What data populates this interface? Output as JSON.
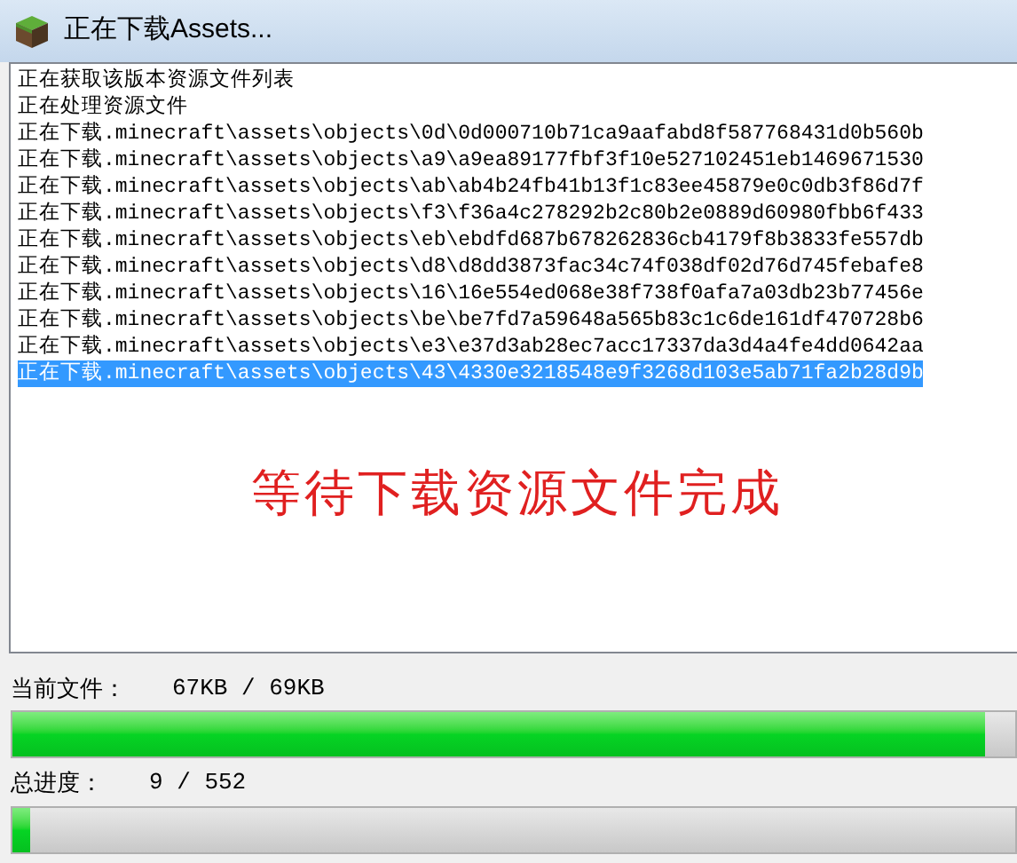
{
  "window": {
    "title": "正在下载Assets..."
  },
  "log": {
    "lines": [
      {
        "text": "正在获取该版本资源文件列表",
        "selected": false
      },
      {
        "text": "正在处理资源文件",
        "selected": false
      },
      {
        "text": "正在下载.minecraft\\assets\\objects\\0d\\0d000710b71ca9aafabd8f587768431d0b560b",
        "selected": false
      },
      {
        "text": "正在下载.minecraft\\assets\\objects\\a9\\a9ea89177fbf3f10e527102451eb1469671530",
        "selected": false
      },
      {
        "text": "正在下载.minecraft\\assets\\objects\\ab\\ab4b24fb41b13f1c83ee45879e0c0db3f86d7f",
        "selected": false
      },
      {
        "text": "正在下载.minecraft\\assets\\objects\\f3\\f36a4c278292b2c80b2e0889d60980fbb6f433",
        "selected": false
      },
      {
        "text": "正在下载.minecraft\\assets\\objects\\eb\\ebdfd687b678262836cb4179f8b3833fe557db",
        "selected": false
      },
      {
        "text": "正在下载.minecraft\\assets\\objects\\d8\\d8dd3873fac34c74f038df02d76d745febafe8",
        "selected": false
      },
      {
        "text": "正在下载.minecraft\\assets\\objects\\16\\16e554ed068e38f738f0afa7a03db23b77456e",
        "selected": false
      },
      {
        "text": "正在下载.minecraft\\assets\\objects\\be\\be7fd7a59648a565b83c1c6de161df470728b6",
        "selected": false
      },
      {
        "text": "正在下载.minecraft\\assets\\objects\\e3\\e37d3ab28ec7acc17337da3d4a4fe4dd0642aa",
        "selected": false
      },
      {
        "text": "正在下载.minecraft\\assets\\objects\\43\\4330e3218548e9f3268d103e5ab71fa2b28d9b",
        "selected": true
      }
    ],
    "message": "等待下载资源文件完成"
  },
  "current_file": {
    "label": "当前文件：",
    "reading": "67KB / 69KB",
    "level": 0.97
  },
  "total": {
    "label": "总进度：",
    "reading": "9 / 552",
    "level": 0.017
  }
}
